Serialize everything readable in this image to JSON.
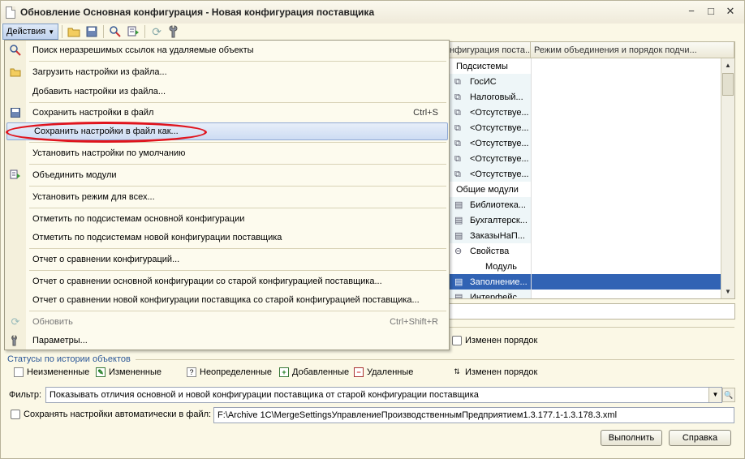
{
  "window": {
    "title": "Обновление Основная конфигурация - Новая конфигурация поставщика",
    "controls": {
      "minimize": "−",
      "maximize": "□",
      "close": "✕"
    }
  },
  "toolbar": {
    "actions_label": "Действия",
    "icons": [
      "folder-open-icon",
      "save-icon",
      "search-links-icon",
      "merge-modules-icon",
      "refresh-icon",
      "settings-icon"
    ]
  },
  "grid": {
    "columns": [
      "нфигурация поста...",
      "Режим объединения и порядок подчи..."
    ],
    "rows": [
      {
        "text": "Подсистемы",
        "icon": "",
        "plain": true
      },
      {
        "text": "ГосИС",
        "icon": "subsystem-icon"
      },
      {
        "text": "Налоговый...",
        "icon": "subsystem-icon"
      },
      {
        "text": "<Отсутствуе...",
        "icon": "subsystem-icon"
      },
      {
        "text": "<Отсутствуе...",
        "icon": "subsystem-icon"
      },
      {
        "text": "<Отсутствуе...",
        "icon": "subsystem-icon"
      },
      {
        "text": "<Отсутствуе...",
        "icon": "subsystem-icon"
      },
      {
        "text": "<Отсутствуе...",
        "icon": "subsystem-icon"
      },
      {
        "text": "Общие модули",
        "icon": "",
        "plain": true
      },
      {
        "text": "Библиотека...",
        "icon": "module-icon"
      },
      {
        "text": "Бухгалтерск...",
        "icon": "module-icon"
      },
      {
        "text": "ЗаказыНаП...",
        "icon": "module-icon"
      },
      {
        "text": "Свойства",
        "icon": "collapse-icon",
        "plain": true
      },
      {
        "text": "Модуль",
        "icon": "",
        "plain": true,
        "indent": true
      },
      {
        "text": "Заполнение...",
        "icon": "module-icon",
        "selected": true
      },
      {
        "text": "Интерфейс...",
        "icon": "module-icon"
      }
    ]
  },
  "menu": {
    "items": [
      {
        "label": "Поиск неразрешимых ссылок на удаляемые объекты",
        "icon": "search-links-icon"
      },
      {
        "label": "Загрузить настройки из файла...",
        "icon": "folder-open-icon"
      },
      {
        "label": "Добавить настройки из файла...",
        "icon": ""
      },
      {
        "label": "Сохранить настройки в файл",
        "icon": "save-icon",
        "shortcut": "Ctrl+S"
      },
      {
        "label": "Сохранить настройки в файл как...",
        "icon": "",
        "highlighted": true
      },
      {
        "label": "Установить настройки по умолчанию",
        "icon": ""
      },
      {
        "label": "Объединить модули",
        "icon": "merge-modules-icon"
      },
      {
        "label": "Установить режим для всех...",
        "icon": ""
      },
      {
        "label": "Отметить по подсистемам основной конфигурации",
        "icon": ""
      },
      {
        "label": "Отметить по подсистемам новой конфигурации поставщика",
        "icon": ""
      },
      {
        "label": "Отчет о сравнении конфигураций...",
        "icon": ""
      },
      {
        "label": "Отчет о сравнении основной конфигурации со старой конфигурацией поставщика...",
        "icon": ""
      },
      {
        "label": "Отчет о сравнении новой конфигурации поставщика со старой конфигурацией поставщика...",
        "icon": ""
      },
      {
        "label": "Обновить",
        "icon": "refresh-icon",
        "shortcut": "Ctrl+Shift+R",
        "disabled": true
      },
      {
        "label": "Параметры...",
        "icon": "settings-icon"
      }
    ]
  },
  "legend": {
    "order_changed_top": "Изменен порядок",
    "title": "Статусы по истории объектов",
    "items": [
      {
        "label": "Неизмененные",
        "icon": "unchanged-icon"
      },
      {
        "label": "Измененные",
        "icon": "changed-icon"
      },
      {
        "label": "Неопределенные",
        "icon": "undefined-icon"
      },
      {
        "label": "Добавленные",
        "icon": "added-icon"
      },
      {
        "label": "Удаленные",
        "icon": "deleted-icon"
      },
      {
        "label": "Изменен порядок",
        "icon": "order-changed-icon"
      }
    ]
  },
  "filter": {
    "label": "Фильтр:",
    "value": "Показывать отличия основной и новой конфигурации поставщика от старой конфигурации поставщика"
  },
  "autosave": {
    "label": "Сохранять настройки автоматически в файл:",
    "path": "F:\\Archive 1C\\MergeSettingsУправлениеПроизводственнымПредприятием1.3.177.1-1.3.178.3.xml"
  },
  "buttons": {
    "execute": "Выполнить",
    "help": "Справка"
  },
  "colors": {
    "accent": "#3163b4",
    "annotation": "#e0141d",
    "background": "#fbf8e6"
  }
}
